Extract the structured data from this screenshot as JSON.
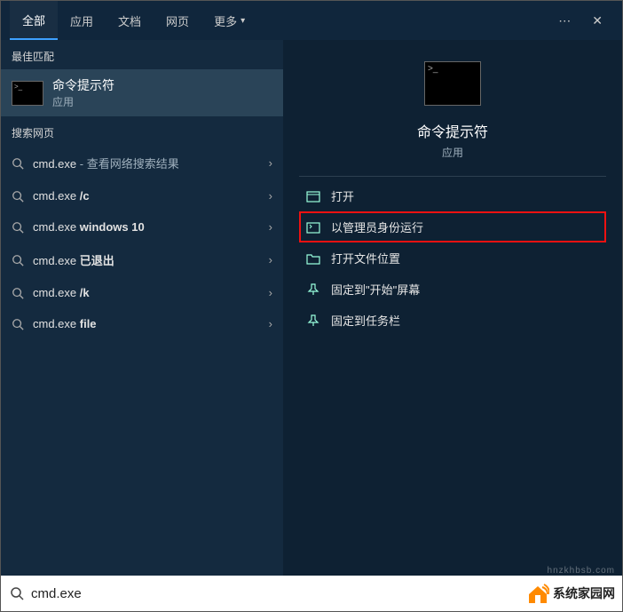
{
  "tabs": {
    "all": "全部",
    "apps": "应用",
    "docs": "文档",
    "web": "网页",
    "more": "更多"
  },
  "left": {
    "bestmatch_label": "最佳匹配",
    "bestmatch_title": "命令提示符",
    "bestmatch_sub": "应用",
    "searchweb_label": "搜索网页",
    "items": [
      {
        "prefix": "cmd.exe",
        "suffix": "",
        "extra": " - 查看网络搜索结果"
      },
      {
        "prefix": "cmd.exe ",
        "suffix": "/c",
        "extra": ""
      },
      {
        "prefix": "cmd.exe ",
        "suffix": "windows 10",
        "extra": ""
      },
      {
        "prefix": "cmd.exe ",
        "suffix": "已退出",
        "extra": ""
      },
      {
        "prefix": "cmd.exe ",
        "suffix": "/k",
        "extra": ""
      },
      {
        "prefix": "cmd.exe ",
        "suffix": "file",
        "extra": ""
      }
    ]
  },
  "right": {
    "title": "命令提示符",
    "sub": "应用",
    "actions": {
      "open": "打开",
      "runadmin": "以管理员身份运行",
      "openloc": "打开文件位置",
      "pinstart": "固定到\"开始\"屏幕",
      "pintask": "固定到任务栏"
    }
  },
  "search": {
    "value": "cmd.exe"
  },
  "brand": "系统家园网",
  "watermark": "hnzkhbsb.com"
}
